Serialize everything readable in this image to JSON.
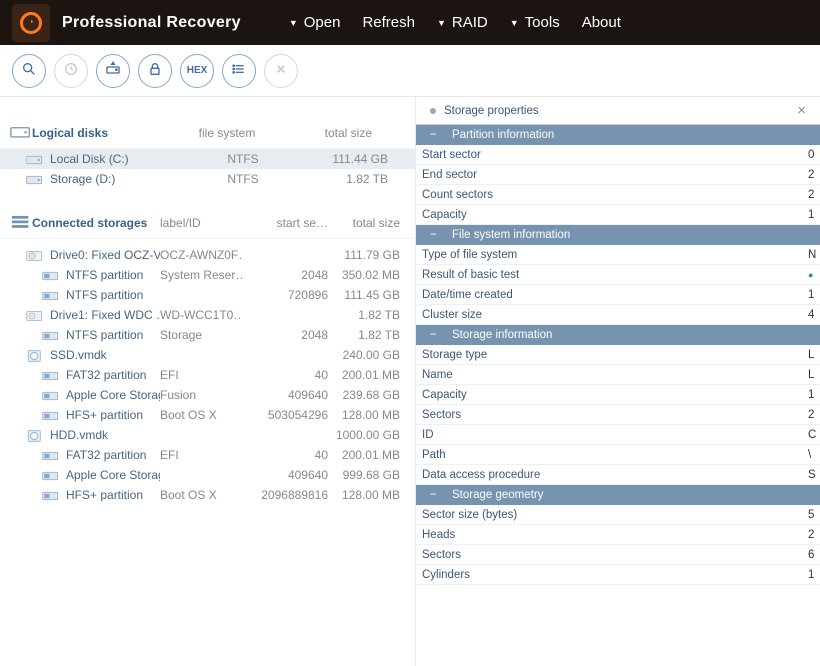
{
  "app": {
    "title": "Professional Recovery"
  },
  "menu": [
    "Open",
    "Refresh",
    "RAID",
    "Tools",
    "About"
  ],
  "menu_has_caret": [
    true,
    false,
    true,
    true,
    false
  ],
  "toolbar": [
    "search",
    "clock",
    "eject",
    "lock",
    "hex",
    "list",
    "close"
  ],
  "toolbar_enabled": [
    true,
    false,
    true,
    true,
    true,
    true,
    false
  ],
  "toolbar_label_hex": "HEX",
  "sections": {
    "logical": {
      "title": "Logical disks",
      "cols": [
        "file system",
        "total size"
      ]
    },
    "connected": {
      "title": "Connected storages",
      "cols": [
        "label/ID",
        "start se…",
        "total size"
      ]
    }
  },
  "logical_disks": [
    {
      "name": "Local Disk (C:)",
      "fs": "NTFS",
      "size": "111.44 GB",
      "selected": true
    },
    {
      "name": "Storage (D:)",
      "fs": "NTFS",
      "size": "1.82 TB",
      "selected": false
    }
  ],
  "storages": [
    {
      "type": "drive",
      "name": "Drive0: Fixed OCZ-V…",
      "label": "OCZ-AWNZ0F…",
      "start": "",
      "size": "111.79 GB"
    },
    {
      "type": "part",
      "name": "NTFS partition",
      "label": "System Reser…",
      "start": "2048",
      "size": "350.02 MB"
    },
    {
      "type": "part",
      "name": "NTFS partition",
      "label": "",
      "start": "720896",
      "size": "111.45 GB"
    },
    {
      "type": "drive",
      "name": "Drive1: Fixed WDC …",
      "label": "WD-WCC1T0…",
      "start": "",
      "size": "1.82 TB"
    },
    {
      "type": "part",
      "name": "NTFS partition",
      "label": "Storage",
      "start": "2048",
      "size": "1.82 TB"
    },
    {
      "type": "vmdk",
      "name": "SSD.vmdk",
      "label": "",
      "start": "",
      "size": "240.00 GB"
    },
    {
      "type": "part",
      "name": "FAT32 partition",
      "label": "EFI",
      "start": "40",
      "size": "200.01 MB"
    },
    {
      "type": "part",
      "name": "Apple Core Storage…",
      "label": "Fusion",
      "start": "409640",
      "size": "239.68 GB"
    },
    {
      "type": "part",
      "name": "HFS+ partition",
      "label": "Boot OS X",
      "start": "503054296",
      "size": "128.00 MB"
    },
    {
      "type": "vmdk",
      "name": "HDD.vmdk",
      "label": "",
      "start": "",
      "size": "1000.00 GB"
    },
    {
      "type": "part",
      "name": "FAT32 partition",
      "label": "EFI",
      "start": "40",
      "size": "200.01 MB"
    },
    {
      "type": "part",
      "name": "Apple Core Storage…",
      "label": "",
      "start": "409640",
      "size": "999.68 GB"
    },
    {
      "type": "part",
      "name": "HFS+ partition",
      "label": "Boot OS X",
      "start": "2096889816",
      "size": "128.00 MB"
    }
  ],
  "props_tab_title": "Storage properties",
  "prop_groups": [
    {
      "title": "Partition information",
      "rows": [
        {
          "k": "Start sector",
          "v": "0"
        },
        {
          "k": "End sector",
          "v": "2"
        },
        {
          "k": "Count sectors",
          "v": "2"
        },
        {
          "k": "Capacity",
          "v": "1"
        }
      ]
    },
    {
      "title": "File system information",
      "rows": [
        {
          "k": "Type of file system",
          "v": "N"
        },
        {
          "k": "Result of basic test",
          "v": "●",
          "ok": true
        },
        {
          "k": "Date/time created",
          "v": "1"
        },
        {
          "k": "Cluster size",
          "v": "4"
        }
      ]
    },
    {
      "title": "Storage information",
      "rows": [
        {
          "k": "Storage type",
          "v": "L"
        },
        {
          "k": "Name",
          "v": "L"
        },
        {
          "k": "Capacity",
          "v": "1"
        },
        {
          "k": "Sectors",
          "v": "2"
        },
        {
          "k": "ID",
          "v": "C"
        },
        {
          "k": "Path",
          "v": "\\"
        },
        {
          "k": "Data access procedure",
          "v": "S"
        }
      ]
    },
    {
      "title": "Storage geometry",
      "rows": [
        {
          "k": "Sector size (bytes)",
          "v": "5"
        },
        {
          "k": "Heads",
          "v": "2"
        },
        {
          "k": "Sectors",
          "v": "6"
        },
        {
          "k": "Cylinders",
          "v": "1"
        }
      ]
    }
  ]
}
